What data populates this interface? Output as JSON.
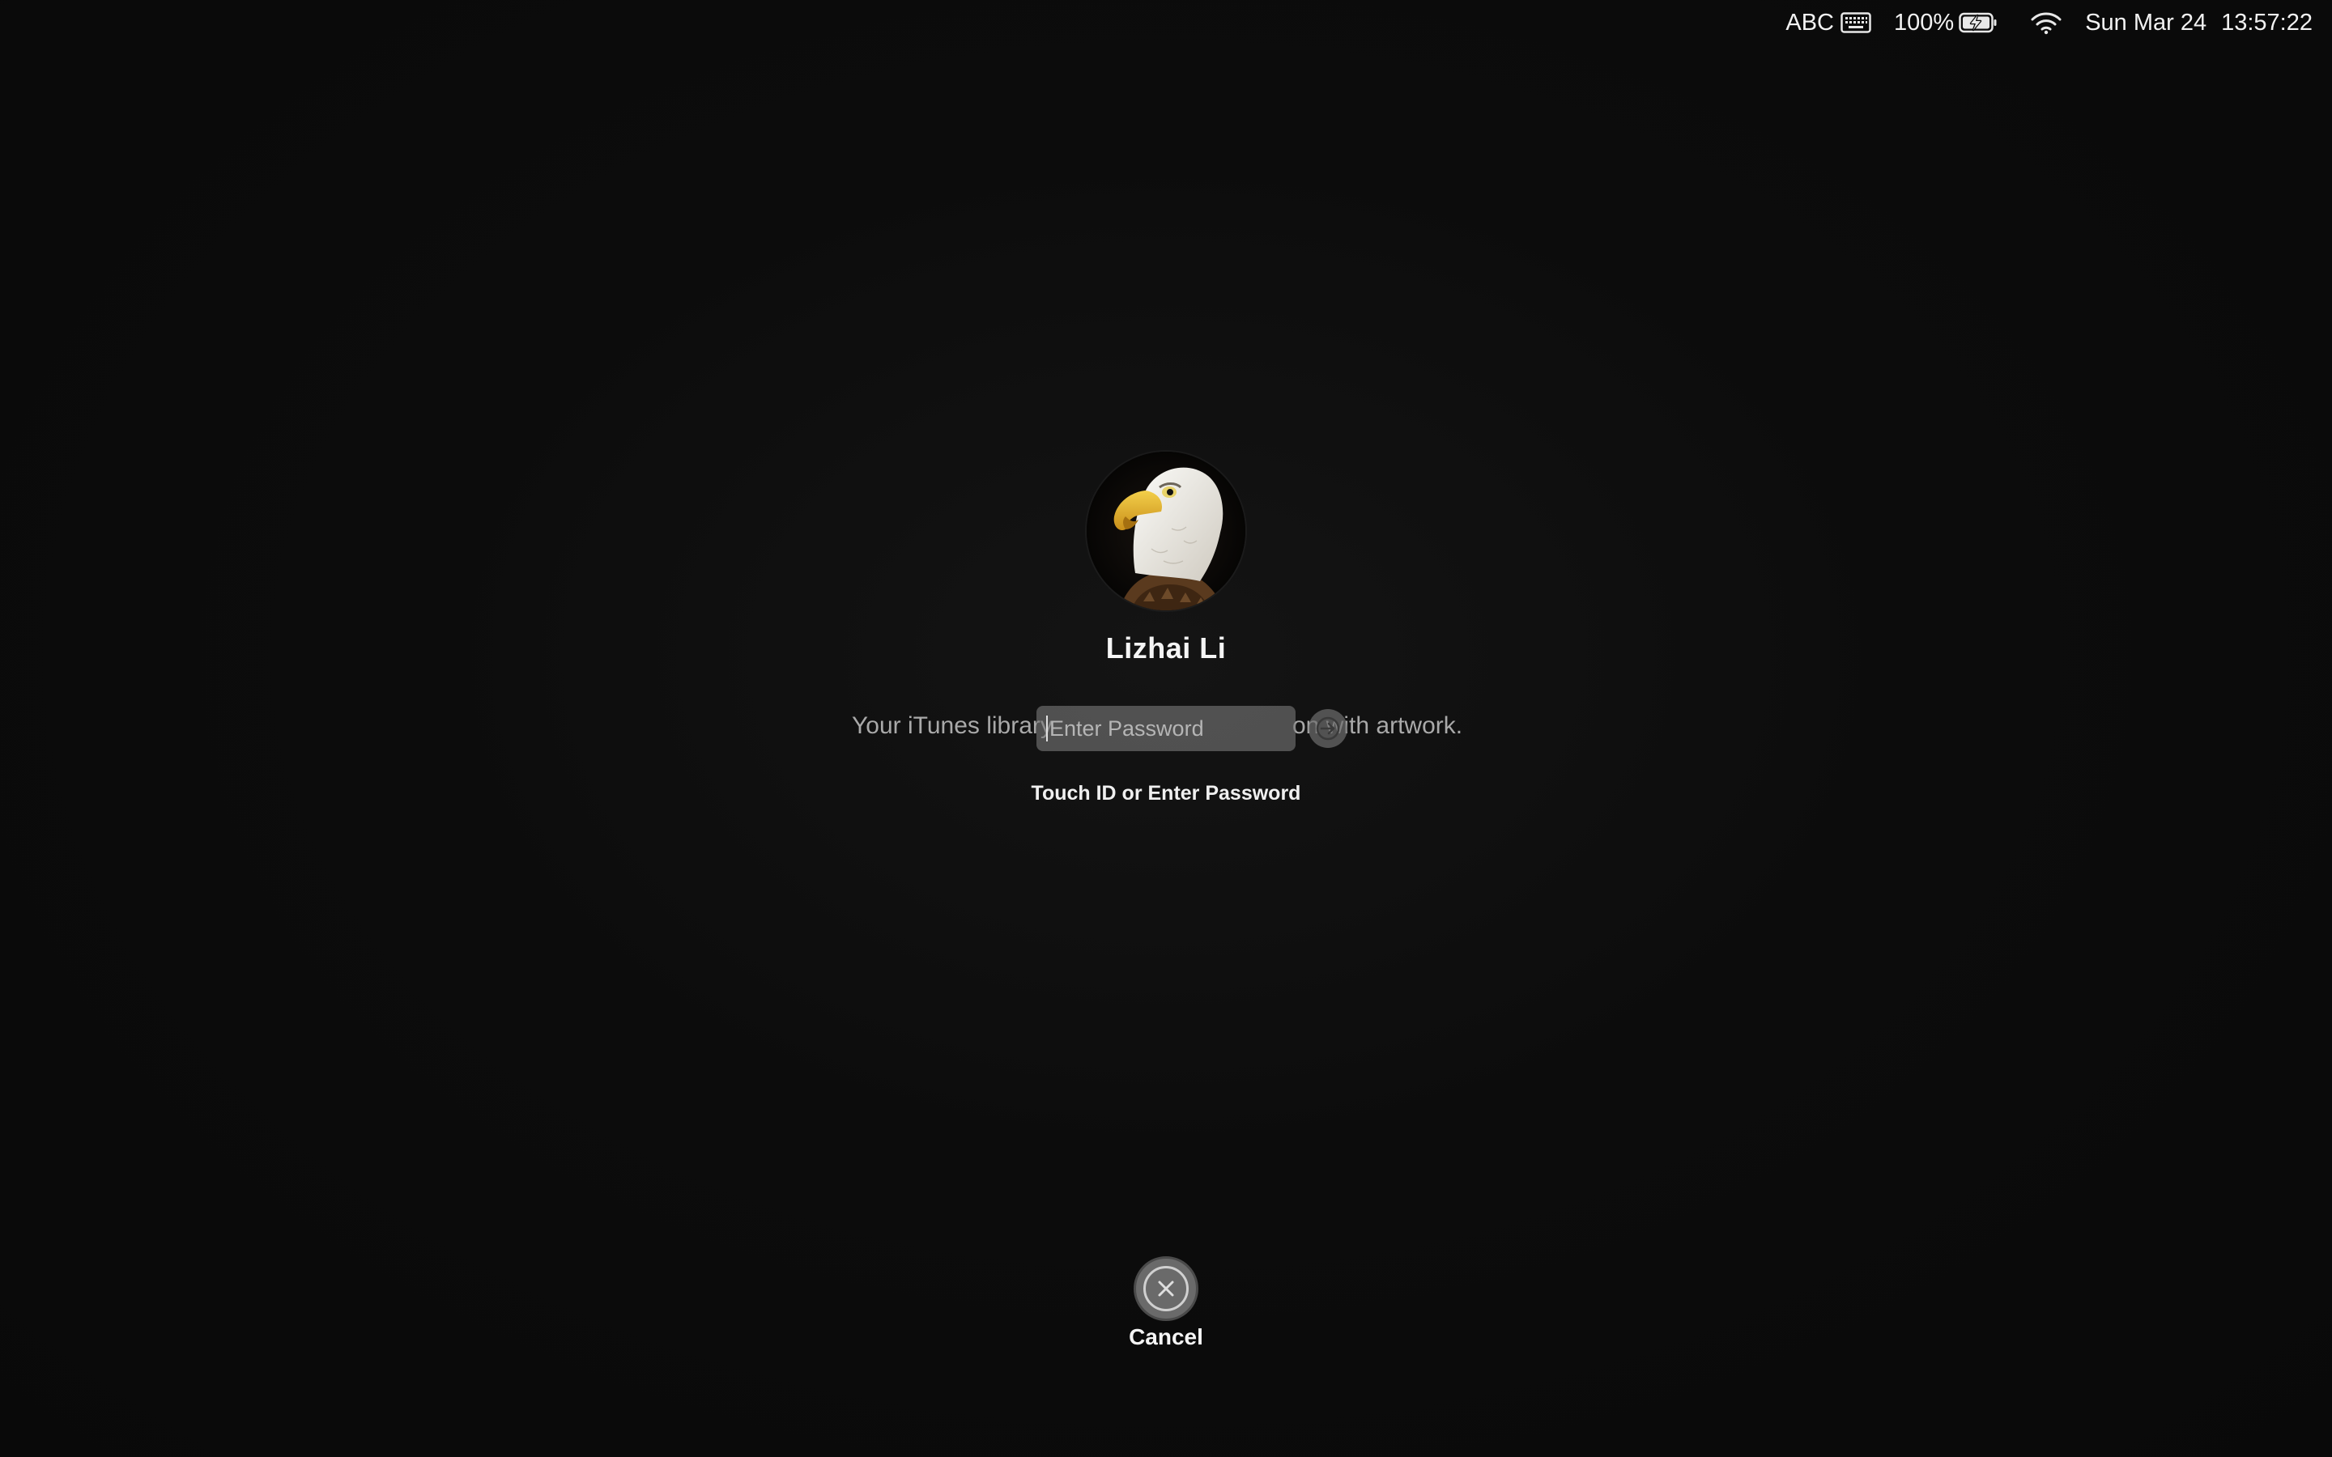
{
  "menubar": {
    "input_source": "ABC",
    "keyboard_icon": "keyboard-icon",
    "battery_percent": "100%",
    "battery_icon": "battery-charging-icon",
    "wifi_icon": "wifi-icon",
    "date": "Sun Mar 24",
    "time": "13:57:22"
  },
  "login": {
    "avatar_icon": "eagle-avatar-icon",
    "username": "Lizhai Li",
    "password_placeholder": "Enter Password",
    "password_value": "",
    "submit_icon": "arrow-right-icon",
    "hint": "Touch ID or Enter Password",
    "cancel_icon": "close-icon",
    "cancel_label": "Cancel"
  },
  "background_message": {
    "left_fragment": "Your iTunes library",
    "right_fragment": "on  with artwork."
  },
  "colors": {
    "background": "#0a0a0a",
    "field_fill": "#787878",
    "text": "#ffffff",
    "secondary_text": "#a9a9a9"
  }
}
